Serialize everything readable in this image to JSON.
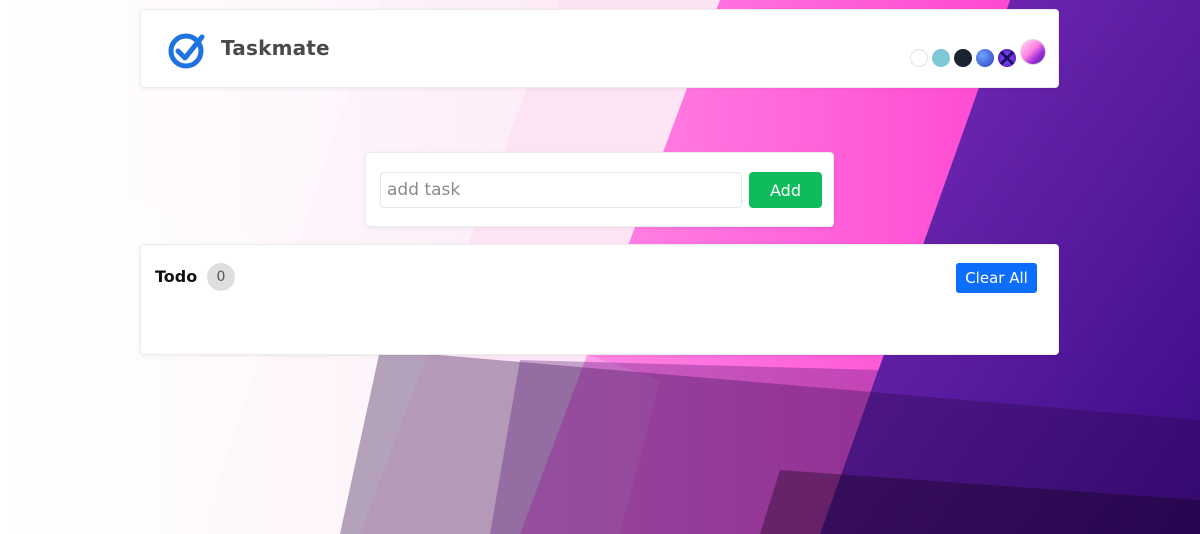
{
  "app": {
    "title": "Taskmate"
  },
  "theme_swatches": [
    {
      "name": "theme-white",
      "color": "#ffffff"
    },
    {
      "name": "theme-light-blue",
      "color": "#7ec8d6"
    },
    {
      "name": "theme-dark-navy",
      "color": "#1b2432"
    },
    {
      "name": "theme-blue-gradient",
      "color": "#3a62d8"
    },
    {
      "name": "theme-purple-cross",
      "color": "#5a2bd8"
    },
    {
      "name": "theme-pink-gradient",
      "color": "#e25bd8"
    }
  ],
  "add_task": {
    "placeholder": "add task",
    "value": "",
    "button_label": "Add"
  },
  "todo": {
    "title": "Todo",
    "count": "0",
    "clear_label": "Clear All"
  },
  "colors": {
    "add_button": "#0fbb5a",
    "clear_button": "#0d6efd",
    "logo": "#1f73e0"
  }
}
